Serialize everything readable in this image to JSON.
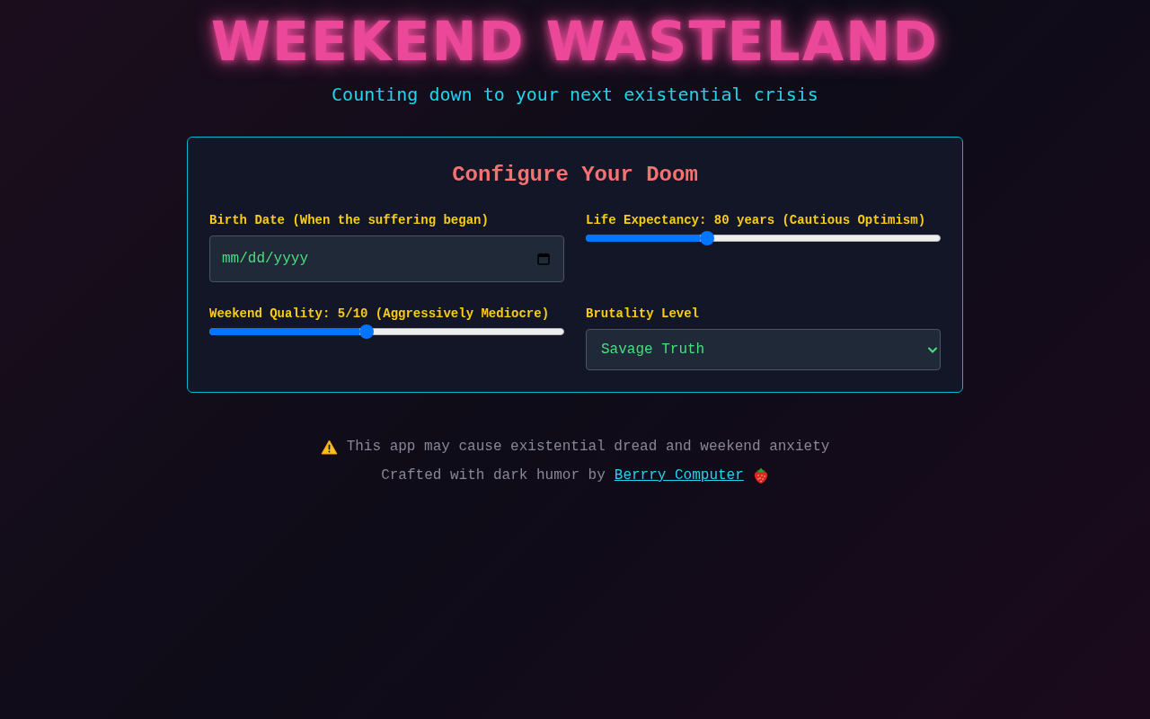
{
  "header": {
    "title": "WEEKEND WASTELAND",
    "subtitle": "Counting down to your next existential crisis"
  },
  "config": {
    "title": "Configure Your Doom",
    "fields": [
      {
        "kind": "date",
        "label": "Birth Date (When the suffering began)",
        "placeholder": "mm/dd/yyyy"
      },
      {
        "kind": "slider",
        "label": "Life Expectancy: 80 years (Cautious Optimism)",
        "level": 0.34
      },
      {
        "kind": "slider",
        "label": "Weekend Quality: 5/10 (Aggressively Mediocre)",
        "level": 0.444
      },
      {
        "kind": "select",
        "label": "Brutality Level",
        "value": "Savage Truth"
      }
    ]
  },
  "footer": {
    "warning": "This app may cause existential dread and weekend anxiety",
    "credit": "Crafted with dark humor by",
    "link": "Berrry Computer"
  }
}
